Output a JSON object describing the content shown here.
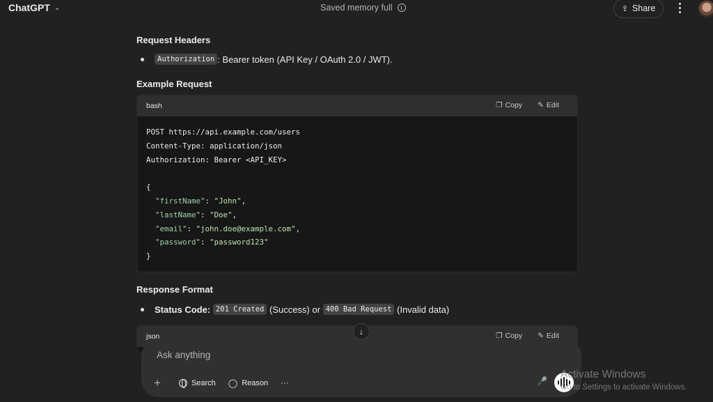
{
  "header": {
    "app_title": "ChatGPT",
    "memory_status": "Saved memory full",
    "share_label": "Share"
  },
  "sections": {
    "request_headers": {
      "title": "Request Headers",
      "bullet_code": "Authorization",
      "bullet_text": ": Bearer token (API Key / OAuth 2.0 / JWT)."
    },
    "example_request": {
      "title": "Example Request",
      "code_lang": "bash",
      "copy_label": "Copy",
      "edit_label": "Edit",
      "lines": {
        "l1": "POST https://api.example.com/users",
        "l2": "Content-Type: application/json",
        "l3": "Authorization: Bearer <API_KEY>",
        "l4": "{",
        "k1": "\"firstName\"",
        "v1": "\"John\"",
        "k2": "\"lastName\"",
        "v2": "\"Doe\"",
        "k3": "\"email\"",
        "v3": "\"john.doe@example.com\"",
        "k4": "\"password\"",
        "v4": "\"password123\"",
        "l9": "}"
      }
    },
    "response_format": {
      "title": "Response Format",
      "status_label": "Status Code:",
      "code_success": "201 Created",
      "text_success": "(Success) or",
      "code_error": "400 Bad Request",
      "text_error": "(Invalid data)",
      "code_lang": "json",
      "copy_label": "Copy",
      "edit_label": "Edit"
    }
  },
  "composer": {
    "placeholder": "Ask anything",
    "search_label": "Search",
    "reason_label": "Reason",
    "more_label": "···"
  },
  "watermark": {
    "line1": "Activate Windows",
    "line2": "Go to Settings to activate Windows."
  },
  "icons": [
    "chevron-down-icon",
    "info-icon",
    "share-icon",
    "kebab-icon",
    "copy-icon",
    "edit-icon",
    "arrow-down-icon",
    "plus-icon",
    "globe-icon",
    "bulb-icon",
    "mic-icon",
    "voice-icon"
  ]
}
